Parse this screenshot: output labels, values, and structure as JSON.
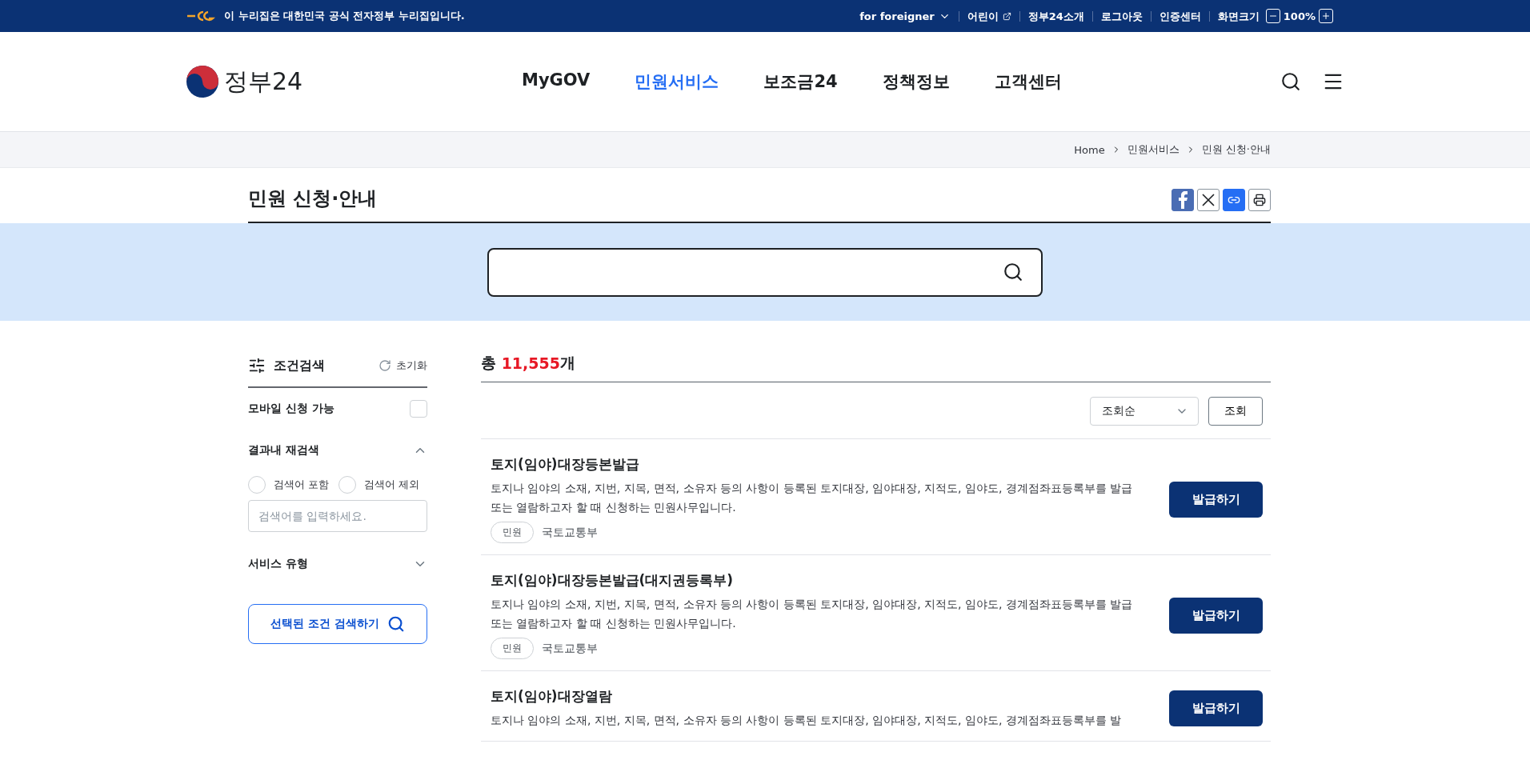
{
  "gov_banner": {
    "text": "이 누리집은 대한민국 공식 전자정부 누리집입니다.",
    "links": [
      {
        "label": "for foreigner",
        "kind": "dropdown"
      },
      {
        "label": "어린이",
        "kind": "external"
      },
      {
        "label": "정부24소개",
        "kind": "plain"
      },
      {
        "label": "로그아웃",
        "kind": "plain"
      },
      {
        "label": "인증센터",
        "kind": "plain"
      }
    ],
    "zoom": {
      "label": "화면크기",
      "value": "100%"
    }
  },
  "header": {
    "logo": "정부24",
    "nav": [
      {
        "label": "MyGOV",
        "selected": false
      },
      {
        "label": "민원서비스",
        "selected": true
      },
      {
        "label": "보조금24",
        "selected": false
      },
      {
        "label": "정책정보",
        "selected": false
      },
      {
        "label": "고객센터",
        "selected": false
      }
    ]
  },
  "breadcrumb": [
    "Home",
    "민원서비스",
    "민원 신청·안내"
  ],
  "page_title": "민원 신청·안내",
  "filter": {
    "title": "조건검색",
    "reset": "초기화",
    "mobile": {
      "label": "모바일 신청 가능",
      "checked": false
    },
    "refine": {
      "label": "결과내 재검색",
      "expanded": true,
      "options": [
        {
          "label": "검색어 포함",
          "selected": false
        },
        {
          "label": "검색어 제외",
          "selected": false
        }
      ],
      "placeholder": "검색어를 입력하세요."
    },
    "service_type": {
      "label": "서비스 유형",
      "expanded": false
    },
    "submit": "선택된 조건 검색하기"
  },
  "results": {
    "total_label": "총",
    "count": "11,555",
    "unit": "개",
    "sort": "조회순",
    "query_button": "조회",
    "items": [
      {
        "title": "토지(임야)대장등본발급",
        "description": "토지나 임야의 소재, 지번, 지목, 면적, 소유자 등의 사항이 등록된 토지대장, 임야대장, 지적도, 임야도, 경계점좌표등록부를 발급 또는 열람하고자 할 때 신청하는 민원사무입니다.",
        "tag": "민원",
        "agency": "국토교통부",
        "action": "발급하기"
      },
      {
        "title": "토지(임야)대장등본발급(대지권등록부)",
        "description": "토지나 임야의 소재, 지번, 지목, 면적, 소유자 등의 사항이 등록된 토지대장, 임야대장, 지적도, 임야도, 경계점좌표등록부를 발급 또는 열람하고자 할 때 신청하는 민원사무입니다.",
        "tag": "민원",
        "agency": "국토교통부",
        "action": "발급하기"
      },
      {
        "title": "토지(임야)대장열람",
        "description": "토지나 임야의 소재, 지번, 지목, 면적, 소유자 등의 사항이 등록된 토지대장, 임야대장, 지적도, 임야도, 경계점좌표등록부를 발",
        "action": "발급하기"
      }
    ]
  }
}
